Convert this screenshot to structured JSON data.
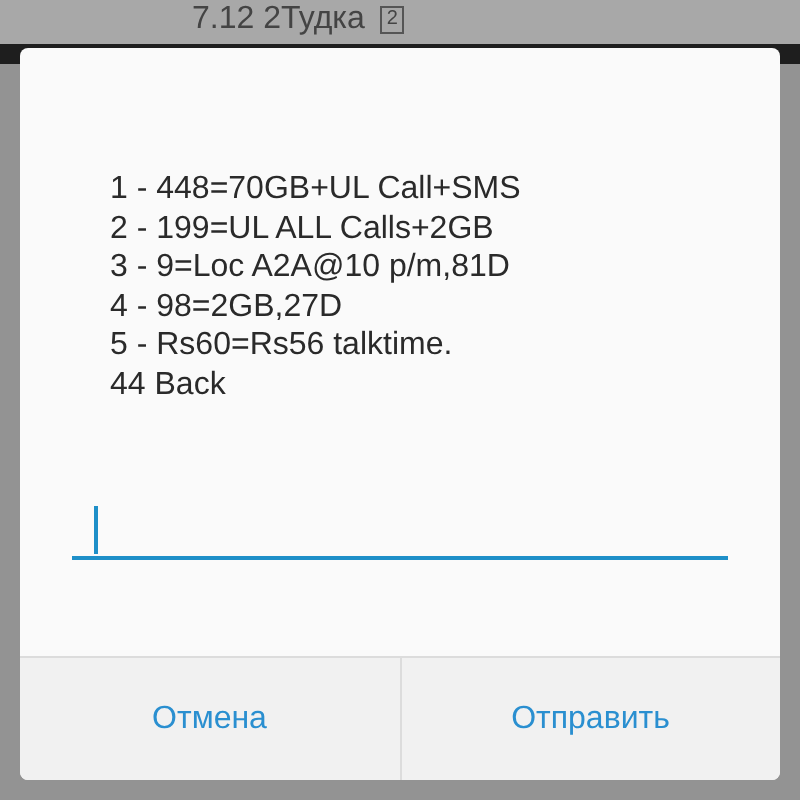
{
  "background": {
    "title": "7.12 2Тудка",
    "badge": "2"
  },
  "dialog": {
    "message_lines": [
      "1 - 448=70GB+UL Call+SMS",
      "2 - 199=UL ALL Calls+2GB",
      "3 - 9=Loc A2A@10 p/m,81D",
      "4 - 98=2GB,27D",
      "5 - Rs60=Rs56 talktime.",
      "44 Back"
    ],
    "buttons": [
      {
        "label": "Отмена"
      },
      {
        "label": "Отправить"
      }
    ]
  }
}
